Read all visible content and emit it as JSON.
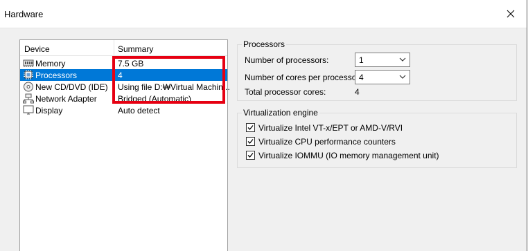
{
  "window": {
    "title": "Hardware"
  },
  "device_list": {
    "headers": {
      "device": "Device",
      "summary": "Summary"
    },
    "rows": [
      {
        "icon": "memory-icon",
        "name": "Memory",
        "summary": "7.5 GB",
        "selected": false
      },
      {
        "icon": "processor-icon",
        "name": "Processors",
        "summary": "4",
        "selected": true
      },
      {
        "icon": "cd-dvd-icon",
        "name": "New CD/DVD (IDE)",
        "summary": "Using file D:₩Virtual Machin...",
        "selected": false
      },
      {
        "icon": "network-adapter-icon",
        "name": "Network Adapter",
        "summary": "Bridged (Automatic)",
        "selected": false
      },
      {
        "icon": "display-icon",
        "name": "Display",
        "summary": "Auto detect",
        "selected": false
      }
    ],
    "highlight_color": "#e60012",
    "selection_color": "#0078d7"
  },
  "processors": {
    "title": "Processors",
    "num_processors_label": "Number of processors:",
    "num_processors_value": "1",
    "cores_label": "Number of cores per processor:",
    "cores_value": "4",
    "total_label": "Total processor cores:",
    "total_value": "4"
  },
  "virtualization": {
    "title": "Virtualization engine",
    "options": [
      {
        "label": "Virtualize Intel VT-x/EPT or AMD-V/RVI",
        "checked": true
      },
      {
        "label": "Virtualize CPU performance counters",
        "checked": true
      },
      {
        "label": "Virtualize IOMMU (IO memory management unit)",
        "checked": true
      }
    ]
  }
}
